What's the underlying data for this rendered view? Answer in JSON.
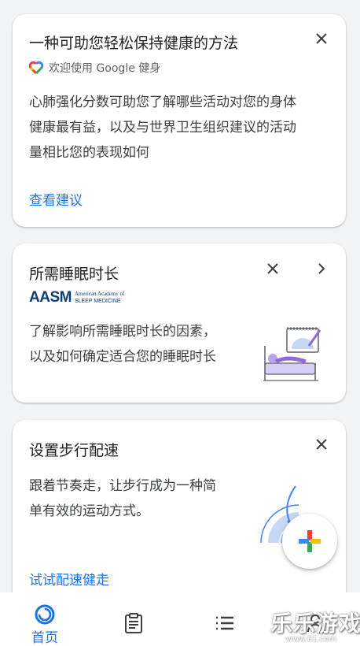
{
  "cards": [
    {
      "title": "一种可助您轻松保持健康的方法",
      "subtitle": "欢迎使用 Google 健身",
      "subtitle_icon": "google-fit-heart-icon",
      "body_line1": "心肺强化分数可助您了解哪些活动对您的身体",
      "body_line2": "健康最有益，以及与世界卫生组织建议的活动",
      "body_line3": "量相比您的表现如何",
      "link": "查看建议"
    },
    {
      "title": "所需睡眠时长",
      "logo": "AASM",
      "logo_small1": "American Academy of",
      "logo_small2": "SLEEP MEDICINE",
      "body_line1": "了解影响所需睡眠时长的因素，",
      "body_line2": "以及如何确定适合您的睡眠时长"
    },
    {
      "title": "设置步行配速",
      "body_line1": "跟着节奏走，让步行成为一种简",
      "body_line2": "单有效的运动方式。",
      "link": "试试配速健走"
    }
  ],
  "nav": [
    {
      "label": "首页",
      "icon": "home-ring-icon",
      "active": true
    },
    {
      "label": "",
      "icon": "journal-clipboard-icon"
    },
    {
      "label": "",
      "icon": "list-icon"
    },
    {
      "label": "",
      "icon": "profile-icon"
    }
  ],
  "watermark": {
    "text": "乐乐游戏",
    "url": "www.61.com"
  },
  "colors": {
    "accent": "#1a73e8",
    "background": "#f1f3f4",
    "text": "#202124"
  }
}
